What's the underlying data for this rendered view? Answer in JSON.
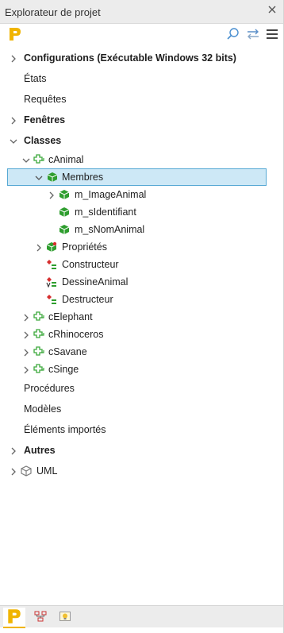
{
  "panel": {
    "title": "Explorateur de projet"
  },
  "toolbar": {
    "logo": "project-logo-icon",
    "buttons": [
      "search-icon",
      "sync-icon",
      "menu-icon"
    ]
  },
  "tree": {
    "configurations": "Configurations (Exécutable Windows 32 bits)",
    "etats": "États",
    "requetes": "Requêtes",
    "fenetres": "Fenêtres",
    "classes": "Classes",
    "canimal": "cAnimal",
    "membres": "Membres",
    "m_imageanimal": "m_ImageAnimal",
    "m_sidentifiant": "m_sIdentifiant",
    "m_snomanimal": "m_sNomAnimal",
    "proprietes": "Propriétés",
    "constructeur": "Constructeur",
    "dessineanimal": "DessineAnimal",
    "destructeur": "Destructeur",
    "celephant": "cElephant",
    "crhinoceros": "cRhinoceros",
    "csavane": "cSavane",
    "csinge": "cSinge",
    "procedures": "Procédures",
    "modeles": "Modèles",
    "elements_importes": "Éléments importés",
    "autres": "Autres",
    "uml": "UML"
  },
  "bottom_tabs": [
    "project-explorer-tab-icon",
    "diagram-tab-icon",
    "image-tab-icon"
  ],
  "colors": {
    "selection_bg": "#cde8f6",
    "selection_border": "#57a9d4",
    "class_icon": "#3aa83a",
    "member_icon": "#2f9e2f",
    "method_icon": "#d62d2d",
    "logo": "#f0b400"
  }
}
